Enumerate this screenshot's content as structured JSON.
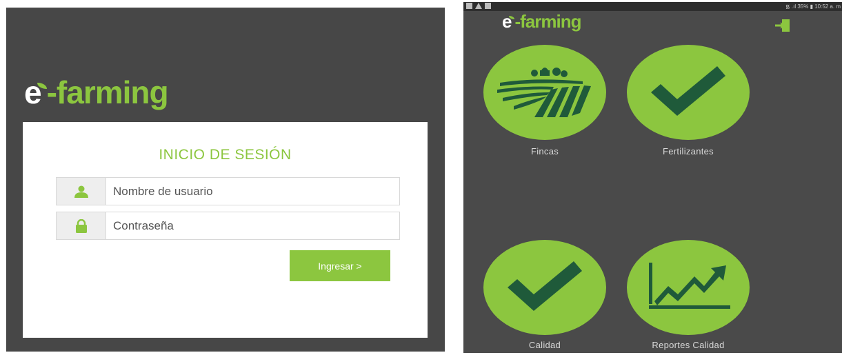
{
  "login_screen": {
    "logo": {
      "e": "e",
      "rest": "-farming"
    },
    "title": "INICIO DE SESIÓN",
    "username": {
      "placeholder": "Nombre de usuario",
      "icon": "user-icon"
    },
    "password": {
      "placeholder": "Contraseña",
      "icon": "lock-icon"
    },
    "submit_label": "Ingresar >"
  },
  "home_screen": {
    "status_bar": {
      "right_text": "᯾ .ıl 35% ▮ 10:52 a. m"
    },
    "logo": {
      "e": "e",
      "rest": "-farming"
    },
    "logout_icon": "logout-icon",
    "tiles": [
      {
        "label": "Fincas",
        "icon": "farm-field-icon"
      },
      {
        "label": "Fertilizantes",
        "icon": "checkmark-icon"
      },
      {
        "label": "Calidad",
        "icon": "checkmark-icon"
      },
      {
        "label": "Reportes Calidad",
        "icon": "trend-chart-icon"
      }
    ]
  },
  "colors": {
    "brand_green": "#8cc63f",
    "dark_green": "#1f5a3a",
    "panel_gray": "#474747"
  }
}
